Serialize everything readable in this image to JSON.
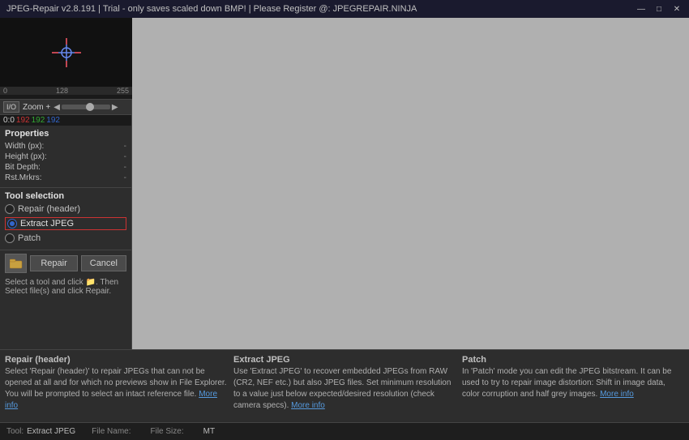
{
  "titlebar": {
    "title": "JPEG-Repair v2.8.191 | Trial - only saves scaled down BMP! | Please Register @: JPEGREPAIR.NINJA",
    "min_btn": "—",
    "max_btn": "□",
    "close_btn": "✕"
  },
  "left_panel": {
    "slider": {
      "min": "0",
      "mid": "128",
      "max": "255"
    },
    "toolbar": {
      "io_label": "I/O",
      "zoom_label": "Zoom +"
    },
    "coords": {
      "xy": "0:0",
      "r": "192",
      "g": "192",
      "b": "192"
    },
    "properties": {
      "title": "Properties",
      "width_label": "Width (px):",
      "width_val": "-",
      "height_label": "Height (px):",
      "height_val": "-",
      "bitdepth_label": "Bit Depth:",
      "bitdepth_val": "-",
      "rstmrkrs_label": "Rst.Mrkrs:",
      "rstmrkrs_val": "-"
    },
    "tool_selection": {
      "title": "Tool selection",
      "repair_label": "Repair (header)",
      "extract_label": "Extract JPEG",
      "patch_label": "Patch"
    },
    "actions": {
      "repair_btn": "Repair",
      "cancel_btn": "Cancel",
      "hint": "Select a tool and click 📁. Then\nSelect file(s) and click Repair."
    }
  },
  "bottom_info": {
    "repair_header": {
      "label": "Repair (header)",
      "desc": "Select 'Repair (header)' to repair JPEGs that can not be opened at all and for which no previews show in File Explorer. You will be prompted to select an intact reference file.",
      "link": "More info"
    },
    "extract_jpeg": {
      "label": "Extract JPEG",
      "desc": "Use 'Extract JPEG' to recover embedded JPEGs from RAW (CR2, NEF etc.) but also JPEG files. Set minimum resolution to a value just below expected/desired resolution (check camera specs).",
      "link": "More info"
    },
    "patch": {
      "label": "Patch",
      "desc": "In 'Patch' mode you can edit the JPEG bitstream. It can be used to try to repair image distortion: Shift in image data, color corruption and half grey images.",
      "link": "More info"
    }
  },
  "status_bar": {
    "tool_label": "Tool:",
    "tool_val": "Extract JPEG",
    "filename_label": "File Name:",
    "filename_val": "",
    "filesize_label": "File Size:",
    "filesize_val": "",
    "mt_label": "MT"
  }
}
